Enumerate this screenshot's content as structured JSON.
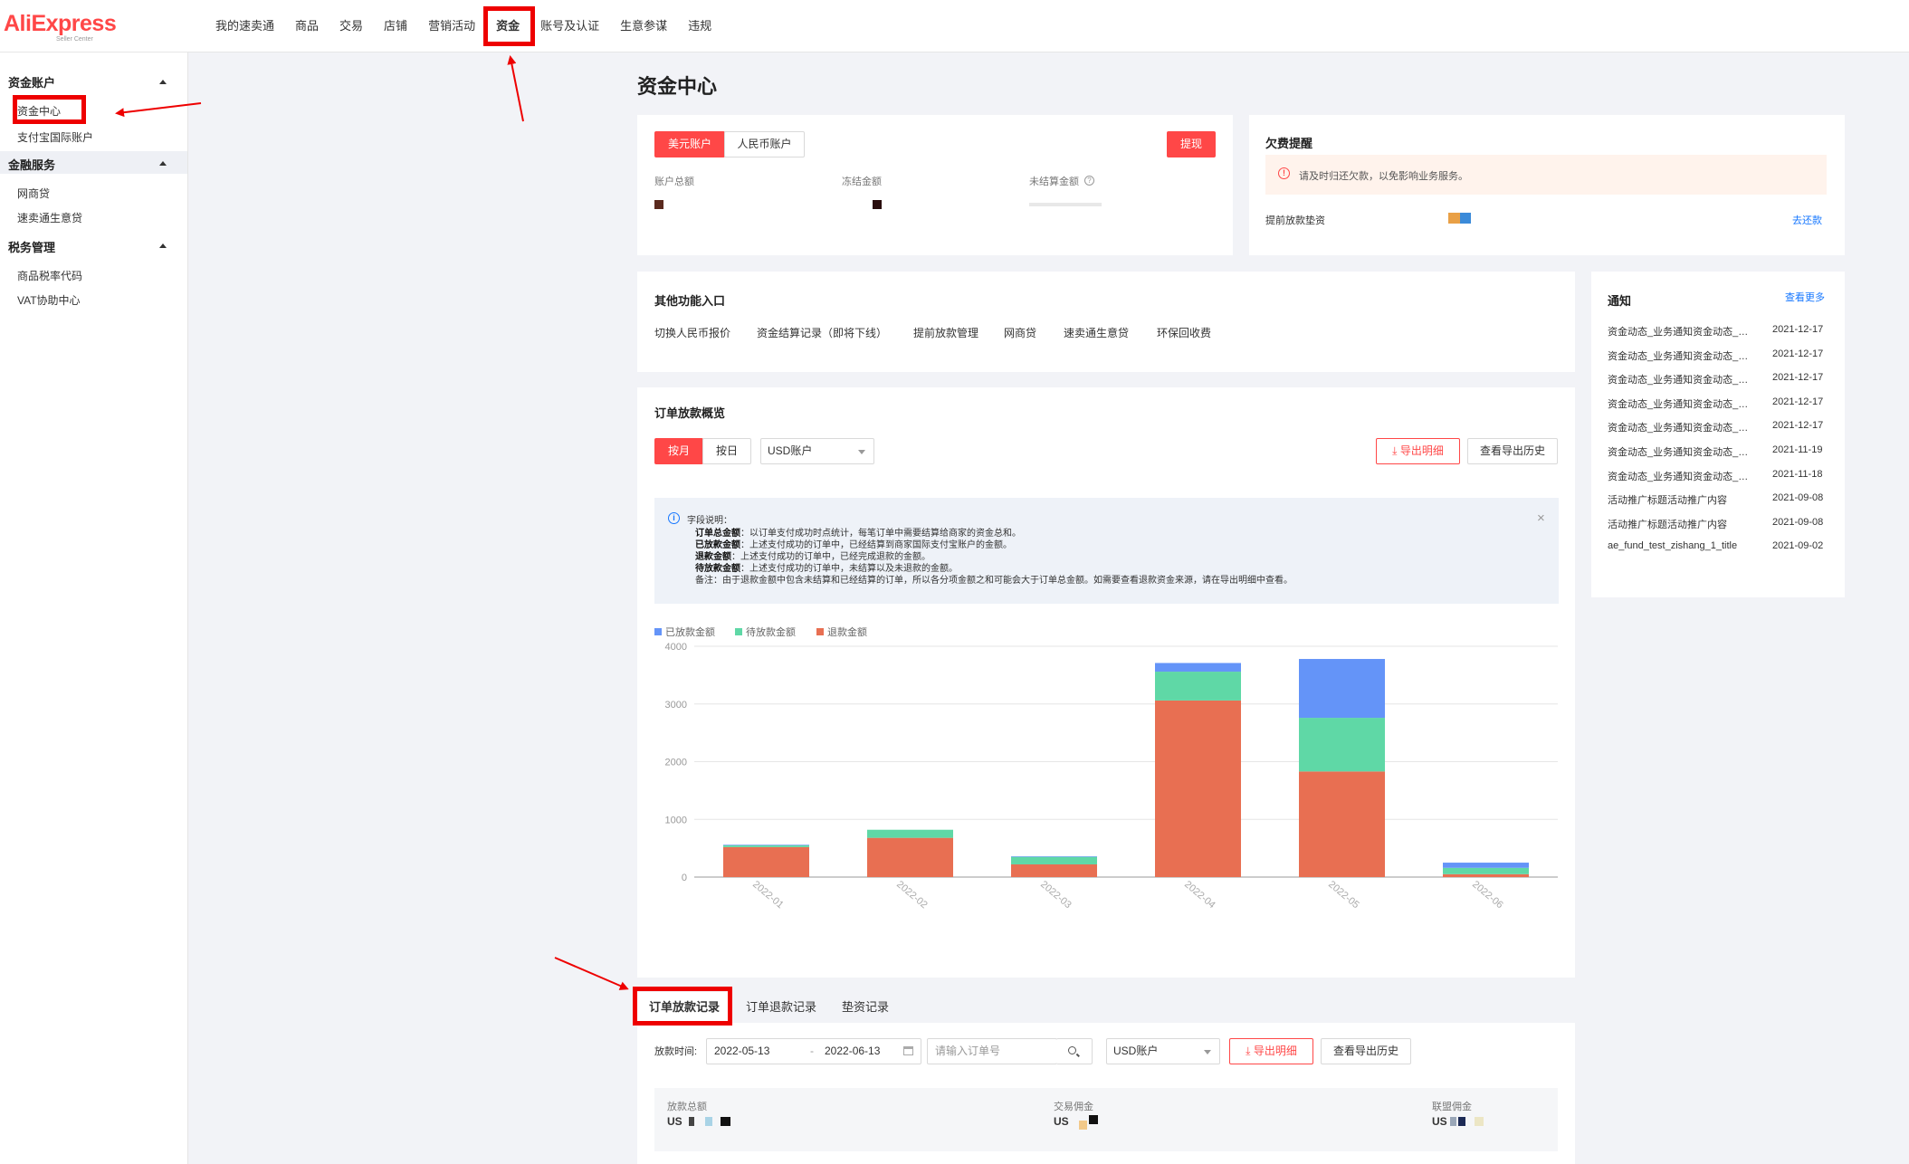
{
  "header": {
    "logo_text": "AliExpress",
    "logo_sub": "Seller Center",
    "nav": [
      "我的速卖通",
      "商品",
      "交易",
      "店铺",
      "营销活动",
      "资金",
      "账号及认证",
      "生意参谋",
      "违规"
    ],
    "active_nav": "资金"
  },
  "sidebar": {
    "groups": [
      {
        "title": "资金账户",
        "items": [
          "资金中心",
          "支付宝国际账户"
        ]
      },
      {
        "title": "金融服务",
        "items": [
          "网商贷",
          "速卖通生意贷"
        ]
      },
      {
        "title": "税务管理",
        "items": [
          "商品税率代码",
          "VAT协助中心"
        ]
      }
    ],
    "active_item": "资金中心"
  },
  "page_title": "资金中心",
  "account": {
    "tabs": [
      "美元账户",
      "人民币账户"
    ],
    "withdraw_button": "提现",
    "fields": [
      "账户总额",
      "冻结金额",
      "未结算金额"
    ],
    "help_icon": "question-circle-icon"
  },
  "arrears": {
    "title": "欠费提醒",
    "warning": "请及时归还欠款，以免影响业务服务。",
    "row_label": "提前放款垫资",
    "repay_link": "去还款"
  },
  "other_functions": {
    "title": "其他功能入口",
    "links": [
      "切换人民币报价",
      "资金结算记录（即将下线）",
      "提前放款管理",
      "网商贷",
      "速卖通生意贷",
      "环保回收费"
    ]
  },
  "notices": {
    "title": "通知",
    "more_link": "查看更多",
    "items": [
      {
        "title": "资金动态_业务通知资金动态_业务通知",
        "date": "2021-12-17"
      },
      {
        "title": "资金动态_业务通知资金动态_业务通知",
        "date": "2021-12-17"
      },
      {
        "title": "资金动态_业务通知资金动态_业务通知",
        "date": "2021-12-17"
      },
      {
        "title": "资金动态_业务通知资金动态_业务通知",
        "date": "2021-12-17"
      },
      {
        "title": "资金动态_业务通知资金动态_业务通知",
        "date": "2021-12-17"
      },
      {
        "title": "资金动态_业务通知资金动态_业务通知",
        "date": "2021-11-19"
      },
      {
        "title": "资金动态_业务通知资金动态_业务通知",
        "date": "2021-11-18"
      },
      {
        "title": "活动推广标题活动推广内容",
        "date": "2021-09-08"
      },
      {
        "title": "活动推广标题活动推广内容",
        "date": "2021-09-08"
      },
      {
        "title": "ae_fund_test_zishang_1_title",
        "date": "2021-09-02"
      }
    ]
  },
  "overview": {
    "title": "订单放款概览",
    "period_tabs": [
      "按月",
      "按日"
    ],
    "currency_select": "USD账户",
    "export_button": "导出明细",
    "history_button": "查看导出历史",
    "info": {
      "title": "字段说明：",
      "lines": [
        {
          "term": "订单总金额",
          "desc": "：以订单支付成功时点统计，每笔订单中需要结算给商家的资金总和。"
        },
        {
          "term": "已放款金额",
          "desc": "：上述支付成功的订单中，已经结算到商家国际支付宝账户的金额。"
        },
        {
          "term": "退款金额",
          "desc": "：上述支付成功的订单中，已经完成退款的金额。"
        },
        {
          "term": "待放款金额",
          "desc": "：上述支付成功的订单中，未结算以及未退款的金额。"
        }
      ],
      "note": "备注：由于退款金额中包含未结算和已经结算的订单，所以各分项金额之和可能会大于订单总金额。如需要查看退款资金来源，请在导出明细中查看。"
    }
  },
  "chart_data": {
    "type": "bar",
    "stacked": true,
    "categories": [
      "2022-01",
      "2022-02",
      "2022-03",
      "2022-04",
      "2022-05",
      "2022-06"
    ],
    "series": [
      {
        "name": "退款金额",
        "color": "#e86f52",
        "values": [
          520,
          680,
          220,
          3060,
          1830,
          50
        ]
      },
      {
        "name": "待放款金额",
        "color": "#5fd8a6",
        "values": [
          30,
          140,
          130,
          500,
          930,
          110
        ]
      },
      {
        "name": "已放款金额",
        "color": "#6494f8",
        "values": [
          10,
          0,
          10,
          150,
          1020,
          90
        ]
      }
    ],
    "legend_order": [
      "已放款金额",
      "待放款金额",
      "退款金额"
    ],
    "ylim": [
      0,
      4000
    ],
    "yticks": [
      0,
      1000,
      2000,
      3000,
      4000
    ],
    "grid": true,
    "legend_position": "top-left"
  },
  "records": {
    "tabs": [
      "订单放款记录",
      "订单退款记录",
      "垫资记录"
    ],
    "active_tab": "订单放款记录",
    "filter_label": "放款时间:",
    "date_start": "2022-05-13",
    "date_end": "2022-06-13",
    "order_placeholder": "请输入订单号",
    "currency_select": "USD账户",
    "export_button": "导出明细",
    "history_button": "查看导出历史",
    "summary": [
      {
        "label": "放款总额",
        "prefix": "US"
      },
      {
        "label": "交易佣金",
        "prefix": "US"
      },
      {
        "label": "联盟佣金",
        "prefix": "US"
      }
    ]
  }
}
